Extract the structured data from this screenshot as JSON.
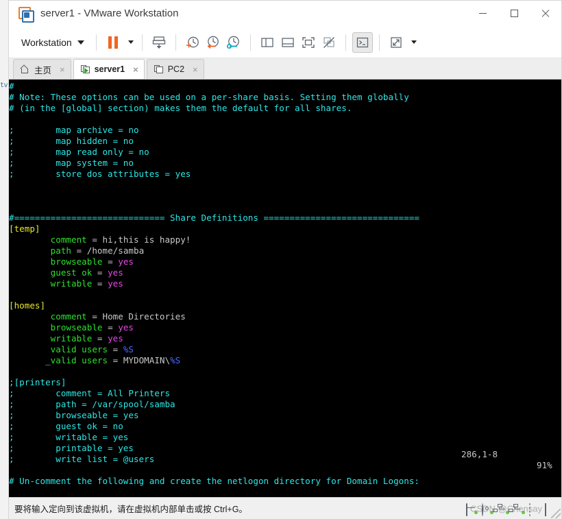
{
  "window": {
    "title": "server1 - VMware Workstation",
    "logo_icon": "vmware-logo-icon",
    "minimize_label": "minimize-icon",
    "maximize_label": "maximize-icon",
    "close_label": "close-icon"
  },
  "toolbar": {
    "menu_label": "Workstation",
    "items": [
      {
        "name": "pause-vm-button",
        "icon": "pause-icon"
      },
      {
        "name": "pause-dropdown-button",
        "icon": "chevron-down-icon"
      },
      {
        "name": "send-ctrl-alt-del-button",
        "icon": "send-key-icon"
      },
      {
        "name": "take-snapshot-button",
        "icon": "snapshot-add-icon"
      },
      {
        "name": "revert-snapshot-button",
        "icon": "snapshot-revert-icon"
      },
      {
        "name": "manage-snapshots-button",
        "icon": "snapshot-manage-icon"
      },
      {
        "name": "show-sidebar-button",
        "icon": "panel-left-icon"
      },
      {
        "name": "show-thumbnail-bar-button",
        "icon": "panel-bottom-icon"
      },
      {
        "name": "full-screen-button",
        "icon": "fullscreen-icon"
      },
      {
        "name": "unity-mode-button",
        "icon": "unity-mode-icon"
      },
      {
        "name": "console-view-button",
        "icon": "console-icon"
      },
      {
        "name": "stretch-guest-button",
        "icon": "stretch-icon"
      },
      {
        "name": "stretch-dropdown-button",
        "icon": "chevron-down-icon"
      }
    ]
  },
  "tabs": [
    {
      "label": "主页",
      "icon": "home-icon",
      "active": false,
      "close": "×"
    },
    {
      "label": "server1",
      "icon": "vm-running-icon",
      "active": true,
      "close": "×"
    },
    {
      "label": "PC2",
      "icon": "vm-icon",
      "active": false,
      "close": "×"
    }
  ],
  "terminal": {
    "editor_status": {
      "position": "286,1-8",
      "percent": "91%"
    },
    "lines": [
      [
        {
          "t": "#",
          "c": "c-cyan"
        }
      ],
      [
        {
          "t": "# Note: These options can be used on a per-share basis. Setting them globally",
          "c": "c-cyan"
        }
      ],
      [
        {
          "t": "# (in the [global] section) makes them the default for all shares.",
          "c": "c-cyan"
        }
      ],
      [
        {
          "t": "",
          "c": "c-cyan"
        }
      ],
      [
        {
          "t": ";        map archive = no",
          "c": "c-cyan"
        }
      ],
      [
        {
          "t": ";        map hidden = no",
          "c": "c-cyan"
        }
      ],
      [
        {
          "t": ";        map read only = no",
          "c": "c-cyan"
        }
      ],
      [
        {
          "t": ";        map system = no",
          "c": "c-cyan"
        }
      ],
      [
        {
          "t": ";        store dos attributes = yes",
          "c": "c-cyan"
        }
      ],
      [
        {
          "t": "",
          "c": "c-cyan"
        }
      ],
      [
        {
          "t": "",
          "c": "c-cyan"
        }
      ],
      [
        {
          "t": "",
          "c": "c-cyan"
        }
      ],
      [
        {
          "t": "#============================= Share Definitions ==============================",
          "c": "c-cyan"
        }
      ],
      [
        {
          "t": "[temp]",
          "c": "c-yellow"
        }
      ],
      [
        {
          "t": "        comment",
          "c": "c-green"
        },
        {
          "t": " = ",
          "c": "c-white"
        },
        {
          "t": "hi,this is happy!",
          "c": "c-white"
        }
      ],
      [
        {
          "t": "        path",
          "c": "c-green"
        },
        {
          "t": " = ",
          "c": "c-white"
        },
        {
          "t": "/home/samba",
          "c": "c-white"
        }
      ],
      [
        {
          "t": "        browseable",
          "c": "c-green"
        },
        {
          "t": " = ",
          "c": "c-white"
        },
        {
          "t": "yes",
          "c": "c-mag"
        }
      ],
      [
        {
          "t": "        guest ok",
          "c": "c-green"
        },
        {
          "t": " = ",
          "c": "c-white"
        },
        {
          "t": "yes",
          "c": "c-mag"
        }
      ],
      [
        {
          "t": "        writable",
          "c": "c-green"
        },
        {
          "t": " = ",
          "c": "c-white"
        },
        {
          "t": "yes",
          "c": "c-mag"
        }
      ],
      [
        {
          "t": "",
          "c": "c-cyan"
        }
      ],
      [
        {
          "t": "[homes]",
          "c": "c-yellow"
        }
      ],
      [
        {
          "t": "        comment",
          "c": "c-green"
        },
        {
          "t": " = ",
          "c": "c-white"
        },
        {
          "t": "Home Directories",
          "c": "c-white"
        }
      ],
      [
        {
          "t": "        browseable",
          "c": "c-green"
        },
        {
          "t": " = ",
          "c": "c-white"
        },
        {
          "t": "yes",
          "c": "c-mag"
        }
      ],
      [
        {
          "t": "        writable",
          "c": "c-green"
        },
        {
          "t": " = ",
          "c": "c-white"
        },
        {
          "t": "yes",
          "c": "c-mag"
        }
      ],
      [
        {
          "t": "        valid users",
          "c": "c-green"
        },
        {
          "t": " = ",
          "c": "c-white"
        },
        {
          "t": "%S",
          "c": "c-blue"
        }
      ],
      [
        {
          "t": "       _",
          "c": "cursor-ul"
        },
        {
          "t": "valid users",
          "c": "c-green"
        },
        {
          "t": " = ",
          "c": "c-white"
        },
        {
          "t": "MYDOMAIN\\",
          "c": "c-white"
        },
        {
          "t": "%S",
          "c": "c-blue"
        }
      ],
      [
        {
          "t": "",
          "c": "c-cyan"
        }
      ],
      [
        {
          "t": ";[printers]",
          "c": "c-cyan"
        }
      ],
      [
        {
          "t": ";        comment = All Printers",
          "c": "c-cyan"
        }
      ],
      [
        {
          "t": ";        path = /var/spool/samba",
          "c": "c-cyan"
        }
      ],
      [
        {
          "t": ";        browseable = yes",
          "c": "c-cyan"
        }
      ],
      [
        {
          "t": ";        guest ok = no",
          "c": "c-cyan"
        }
      ],
      [
        {
          "t": ";        writable = yes",
          "c": "c-cyan"
        }
      ],
      [
        {
          "t": ";        printable = yes",
          "c": "c-cyan"
        }
      ],
      [
        {
          "t": ";        write list = @users",
          "c": "c-cyan"
        }
      ],
      [
        {
          "t": "",
          "c": "c-cyan"
        }
      ],
      [
        {
          "t": "# Un-comment the following and create the netlogon directory for Domain Logons:",
          "c": "c-cyan"
        }
      ]
    ]
  },
  "statusbar": {
    "hint": "要将输入定向到该虚拟机，请在虚拟机内部单击或按 Ctrl+G。",
    "watermark": "CSDN @Chensay",
    "devices": [
      {
        "name": "hard-disk-icon"
      },
      {
        "name": "cd-dvd-icon"
      },
      {
        "name": "network-adapter-icon"
      },
      {
        "name": "network-adapter2-icon"
      },
      {
        "name": "usb-icon"
      },
      {
        "name": "display-icon"
      }
    ]
  },
  "stray": {
    "left_fragment": "tv"
  },
  "colors": {
    "accent_orange": "#f26522",
    "accent_blue": "#2e6fae",
    "terminal_bg": "#000000",
    "cyan": "#2ee6e6",
    "green": "#2ee02e",
    "magenta": "#e64ae6",
    "yellow": "#e6e62e"
  }
}
